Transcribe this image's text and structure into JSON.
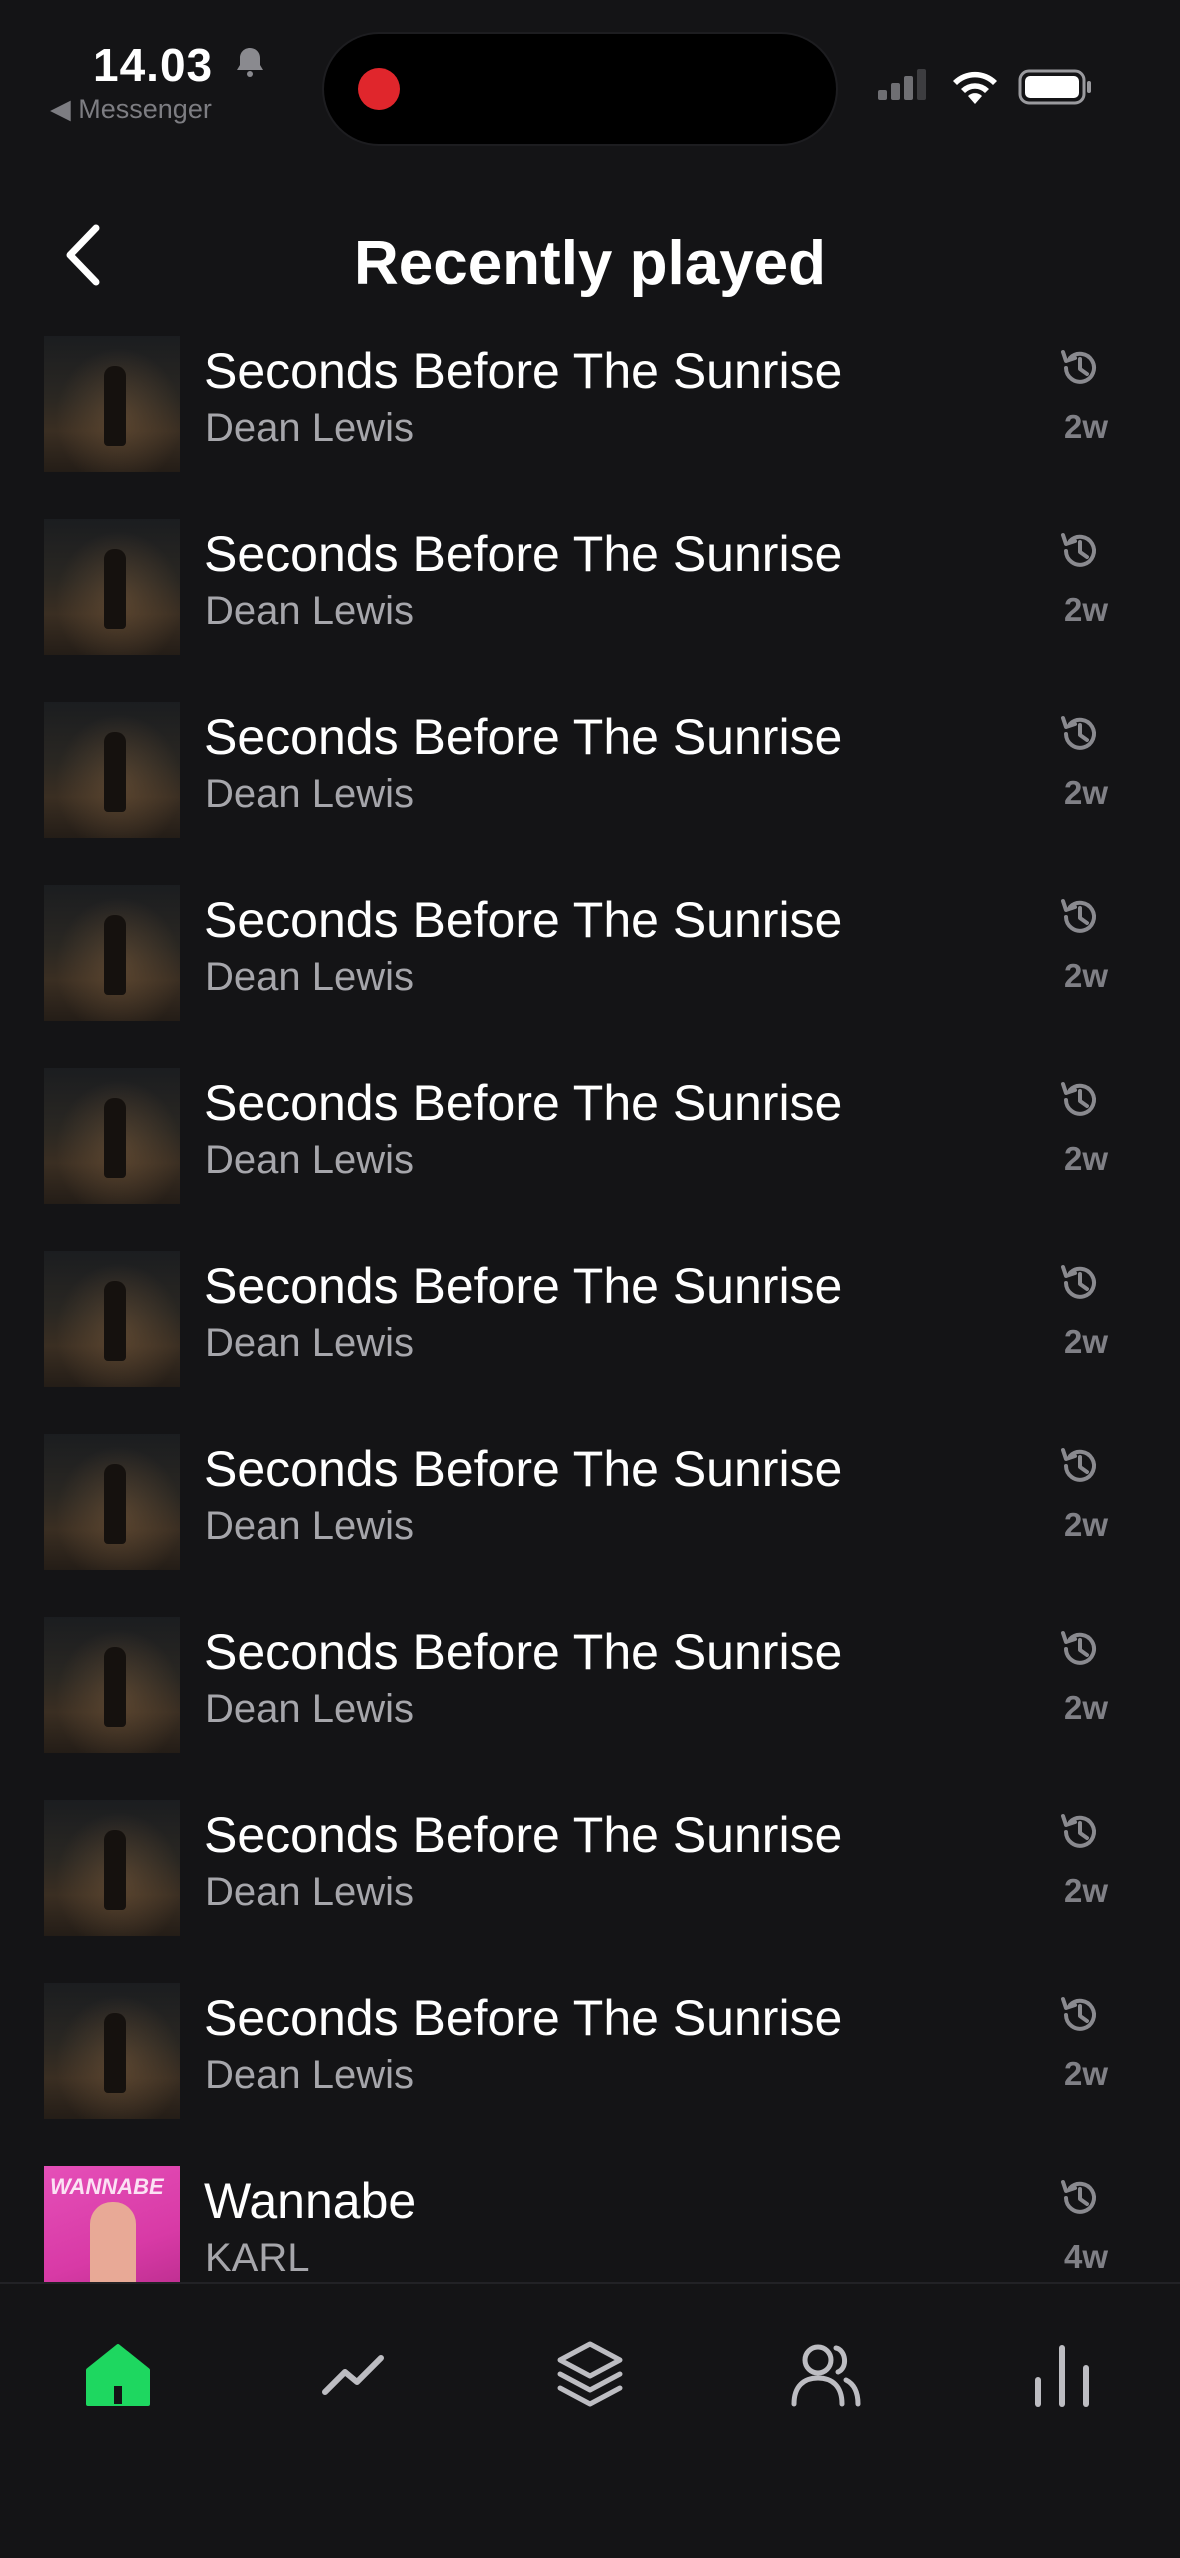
{
  "status_bar": {
    "time": "14.03",
    "back_app": "◀ Messenger"
  },
  "header": {
    "title": "Recently played"
  },
  "colors": {
    "accent": "#1ed760",
    "background": "#141416",
    "secondary_text": "#a6a6ab"
  },
  "tracks": [
    {
      "title": "Seconds Before The Sunrise",
      "artist": "Dean Lewis",
      "ago": "2w",
      "art": "seconds-before-the-sunrise-cover"
    },
    {
      "title": "Seconds Before The Sunrise",
      "artist": "Dean Lewis",
      "ago": "2w",
      "art": "seconds-before-the-sunrise-cover"
    },
    {
      "title": "Seconds Before The Sunrise",
      "artist": "Dean Lewis",
      "ago": "2w",
      "art": "seconds-before-the-sunrise-cover"
    },
    {
      "title": "Seconds Before The Sunrise",
      "artist": "Dean Lewis",
      "ago": "2w",
      "art": "seconds-before-the-sunrise-cover"
    },
    {
      "title": "Seconds Before The Sunrise",
      "artist": "Dean Lewis",
      "ago": "2w",
      "art": "seconds-before-the-sunrise-cover"
    },
    {
      "title": "Seconds Before The Sunrise",
      "artist": "Dean Lewis",
      "ago": "2w",
      "art": "seconds-before-the-sunrise-cover"
    },
    {
      "title": "Seconds Before The Sunrise",
      "artist": "Dean Lewis",
      "ago": "2w",
      "art": "seconds-before-the-sunrise-cover"
    },
    {
      "title": "Seconds Before The Sunrise",
      "artist": "Dean Lewis",
      "ago": "2w",
      "art": "seconds-before-the-sunrise-cover"
    },
    {
      "title": "Seconds Before The Sunrise",
      "artist": "Dean Lewis",
      "ago": "2w",
      "art": "seconds-before-the-sunrise-cover"
    },
    {
      "title": "Seconds Before The Sunrise",
      "artist": "Dean Lewis",
      "ago": "2w",
      "art": "seconds-before-the-sunrise-cover"
    },
    {
      "title": "Wannabe",
      "artist": "KARL",
      "ago": "4w",
      "art": "wannabe-cover",
      "art_text": "WANNABE"
    }
  ],
  "nav": [
    {
      "name": "home",
      "icon": "home-icon",
      "active": true
    },
    {
      "name": "trending",
      "icon": "trending-icon",
      "active": false
    },
    {
      "name": "library",
      "icon": "layers-icon",
      "active": false
    },
    {
      "name": "friends",
      "icon": "users-icon",
      "active": false
    },
    {
      "name": "stats",
      "icon": "bar-chart-icon",
      "active": false
    }
  ]
}
